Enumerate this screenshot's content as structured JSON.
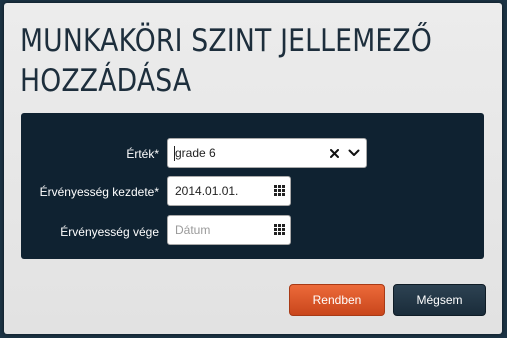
{
  "dialog": {
    "title_line1": "MUNKAKÖRI SZINT JELLEMEZŐ",
    "title_line2": "HOZZÁDÁSA"
  },
  "form": {
    "value_label": "Érték*",
    "value_selected": "grade 6",
    "start_label": "Érvényesség kezdete*",
    "start_value": "2014.01.01.",
    "end_label": "Érvényesség vége",
    "end_placeholder": "Dátum"
  },
  "buttons": {
    "ok_label": "Rendben",
    "cancel_label": "Mégsem"
  },
  "colors": {
    "ok_button": "#e05a2b",
    "cancel_button": "#22394a",
    "panel": "#0f2231",
    "title": "#1d2e3c"
  },
  "icons": {
    "clear": "close-icon",
    "dropdown": "chevron-down-icon",
    "calendar": "calendar-icon"
  }
}
